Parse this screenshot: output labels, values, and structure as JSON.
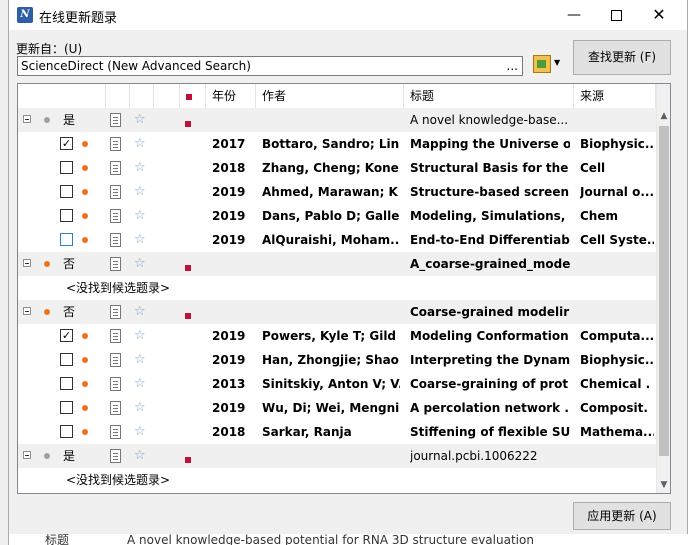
{
  "window": {
    "title": "在线更新题录",
    "icon": "app-logo-icon"
  },
  "update_from": {
    "label": "更新自：(U)",
    "value": "ScienceDirect (New Advanced Search)",
    "dots": "..."
  },
  "buttons": {
    "check": "查找更新 (F)",
    "apply": "应用更新 (A)"
  },
  "columns": [
    "年份",
    "作者",
    "标题",
    "来源"
  ],
  "rows": [
    {
      "type": "group",
      "dot": "grey",
      "match": "是",
      "year": "",
      "author": "",
      "title": "A novel knowledge-base...",
      "source": "",
      "bold": false,
      "flag": true
    },
    {
      "type": "item",
      "checked": true,
      "year": "2017",
      "author": "Bottaro, Sandro; Lin",
      "title": "Mapping the Universe o",
      "source": "Biophysic..."
    },
    {
      "type": "item",
      "checked": false,
      "year": "2018",
      "author": "Zhang, Cheng; Kone",
      "title": "Structural Basis for the .",
      "source": "Cell"
    },
    {
      "type": "item",
      "checked": false,
      "year": "2019",
      "author": "Ahmed, Marawan; K",
      "title": "Structure-based screeni",
      "source": "Journal o..."
    },
    {
      "type": "item",
      "checked": false,
      "year": "2019",
      "author": "Dans, Pablo D; Galle",
      "title": "Modeling, Simulations, &",
      "source": "Chem"
    },
    {
      "type": "item",
      "checked": false,
      "blue": true,
      "year": "2019",
      "author": "AlQuraishi, Moham...",
      "title": "End-to-End Differentiab",
      "source": "Cell Syste..."
    },
    {
      "type": "group",
      "dot": "orange",
      "match": "否",
      "year": "",
      "author": "",
      "title": "A_coarse-grained_mode",
      "source": "",
      "bold": true,
      "flag": true
    },
    {
      "type": "nofound",
      "text": "<没找到候选题录>"
    },
    {
      "type": "group",
      "dot": "orange",
      "match": "否",
      "year": "",
      "author": "",
      "title": "Coarse-grained modelir",
      "source": "",
      "bold": true,
      "flag": true
    },
    {
      "type": "item",
      "checked": true,
      "year": "2019",
      "author": "Powers, Kyle T; Gild",
      "title": "Modeling Conformation",
      "source": "Computa..."
    },
    {
      "type": "item",
      "checked": false,
      "year": "2019",
      "author": "Han, Zhongjie; Shao",
      "title": "Interpreting the Dynami",
      "source": "Biophysic..."
    },
    {
      "type": "item",
      "checked": false,
      "year": "2013",
      "author": "Sinitskiy, Anton V; V.",
      "title": "Coarse-graining of prot",
      "source": "Chemical ."
    },
    {
      "type": "item",
      "checked": false,
      "year": "2019",
      "author": "Wu, Di; Wei, Mengni",
      "title": "A percolation network .",
      "source": "Composit."
    },
    {
      "type": "item",
      "checked": false,
      "year": "2018",
      "author": "Sarkar, Ranja",
      "title": "Stiffening of flexible SU",
      "source": "Mathema..."
    },
    {
      "type": "group",
      "dot": "grey",
      "match": "是",
      "year": "",
      "author": "",
      "title": "journal.pcbi.1006222",
      "source": "",
      "bold": false,
      "flag": true
    },
    {
      "type": "nofound",
      "text": "<没找到候选题录>"
    }
  ],
  "bottom": {
    "label": "标题",
    "value": "A novel knowledge-based potential for RNA 3D structure evaluation"
  },
  "colors": {
    "flag": "#c0103a",
    "dot_orange": "#f07020",
    "dot_grey": "#a0a0a0",
    "star": "#7a9cc6"
  }
}
